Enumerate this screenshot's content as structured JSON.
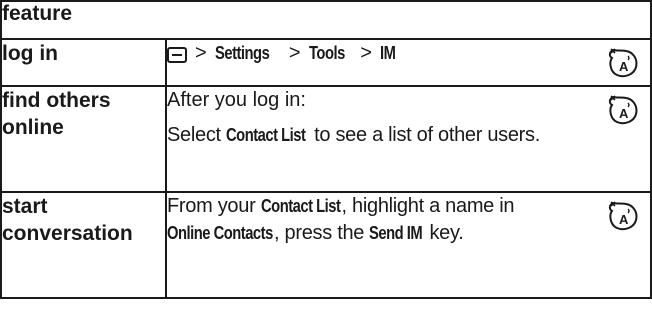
{
  "header": {
    "label": "feature"
  },
  "rows": [
    {
      "name": "log in",
      "path": {
        "settings": "Settings",
        "tools": "Tools",
        "im": "IM",
        "sep": ">"
      },
      "icon": "network-feature-icon"
    },
    {
      "name_line1": "find others",
      "name_line2": "online",
      "intro": "After you log in:",
      "select": "Select",
      "contact_list": "Contact List",
      "rest": "to see a list of other users.",
      "icon": "network-feature-icon"
    },
    {
      "name_line1": "start",
      "name_line2": "conversation",
      "from": "From your",
      "contact_list": "Contact List",
      "highlight": ", highlight a name in",
      "online_contacts": "Online Contacts",
      "press": ", press the",
      "send_im": "Send IM",
      "key": "key.",
      "icon": "network-feature-icon"
    }
  ]
}
